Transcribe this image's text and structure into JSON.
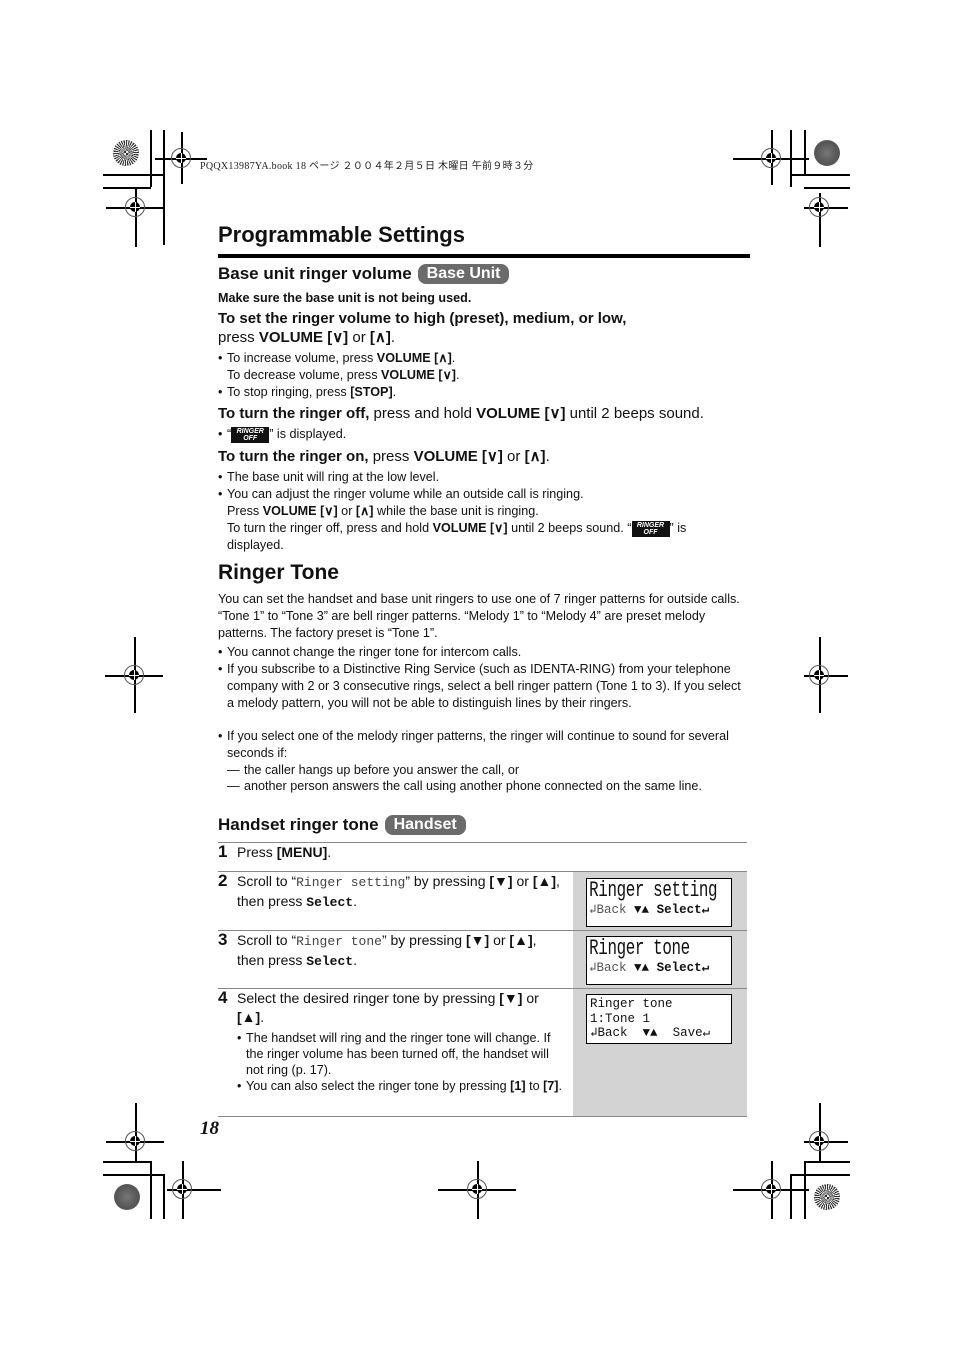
{
  "print_header": "PQQX13987YA.book  18 ページ  ２００４年２月５日  木曜日  午前９時３分",
  "page_title": "Programmable Settings",
  "base_volume": {
    "title": "Base unit ringer volume",
    "badge": "Base Unit",
    "note": "Make sure the base unit is not being used.",
    "set_bold": "To set the ringer volume to high (preset), medium, or low,",
    "set_press": "press ",
    "volume": "VOLUME",
    "down_key": "[∨]",
    "up_key": "[∧]",
    "or": " or ",
    "period": ".",
    "bullet_increase": "To increase volume, press ",
    "bullet_decrease": "To decrease volume, press ",
    "bullet_stop": "To stop ringing, press ",
    "stop_key": "[STOP]",
    "off_bold": "To turn the ringer off,",
    "off_text": " press and hold ",
    "off_tail": " until 2 beeps sound.",
    "ringer_off_icon_top": "RINGER",
    "ringer_off_icon_bottom": "OFF",
    "displayed_pre": "“",
    "displayed_post": "” is displayed.",
    "on_bold": "To turn the ringer on,",
    "on_text": " press ",
    "low_level": "The base unit will ring at the low level.",
    "adjust": "You can adjust the ringer volume while an outside call is ringing.",
    "adjust_press": "Press ",
    "adjust_tail": " while the base unit is ringing.",
    "adjust_off": "To turn the ringer off, press and hold ",
    "adjust_off_tail": " until 2 beeps sound. “",
    "adjust_off_is": "” is",
    "adjust_displayed": "displayed."
  },
  "ringer_tone": {
    "title": "Ringer Tone",
    "intro": "You can set the handset and base unit ringers to use one of 7 ringer patterns for outside calls. “Tone 1” to “Tone 3” are bell ringer patterns. “Melody 1” to “Melody 4” are preset melody patterns. The factory preset is “Tone 1”.",
    "bullets": [
      "You cannot change the ringer tone for intercom calls.",
      "If you subscribe to a Distinctive Ring Service (such as IDENTA-RING) from your telephone company with 2 or 3 consecutive rings, select a bell ringer pattern (Tone 1 to 3). If you select a melody pattern, you will not be able to distinguish lines by their ringers.",
      "If you select one of the melody ringer patterns, the ringer will continue to sound for several seconds if:"
    ],
    "dashes": [
      "the caller hangs up before you answer the call, or",
      "another person answers the call using another phone connected on the same line."
    ]
  },
  "handset_tone": {
    "title": "Handset ringer tone",
    "badge": "Handset",
    "steps": [
      {
        "num": "1",
        "pre": "Press ",
        "key": "[MENU]",
        "post": "."
      },
      {
        "num": "2",
        "pre": "Scroll to “",
        "mono": "Ringer setting",
        "mid": "” by pressing ",
        "k1": "[▼]",
        "or": " or ",
        "k2": "[▲]",
        "then": ", then press ",
        "sel": "Select",
        "post": "."
      },
      {
        "num": "3",
        "pre": "Scroll to “",
        "mono": "Ringer tone",
        "mid": "” by pressing ",
        "k1": "[▼]",
        "or": " or ",
        "k2": "[▲]",
        "then": ", then press ",
        "sel": "Select",
        "post": "."
      },
      {
        "num": "4",
        "pre": "Select the desired ringer tone by pressing ",
        "k1": "[▼]",
        "or": " or ",
        "k2": "[▲]",
        "post": ".",
        "sub1": "The handset will ring and the ringer tone will change. If the ringer volume has been turned off, the handset will not ring (p. 17).",
        "sub2_pre": "You can also select the ringer tone by pressing ",
        "sub2_k1": "[1]",
        "sub2_mid": " to ",
        "sub2_k2": "[7]",
        "sub2_post": "."
      }
    ],
    "displays": [
      {
        "line1": "Ringer setting",
        "back": "↲Back",
        "arrows": "▼▲",
        "action": "Select↵"
      },
      {
        "line1": "Ringer tone",
        "back": "↲Back",
        "arrows": "▼▲",
        "action": "Select↵"
      },
      {
        "line1": "Ringer tone",
        "line2": "1:Tone 1",
        "back": "↲Back",
        "arrows": "▼▲",
        "action": "Save↵"
      }
    ]
  },
  "page_number": "18"
}
